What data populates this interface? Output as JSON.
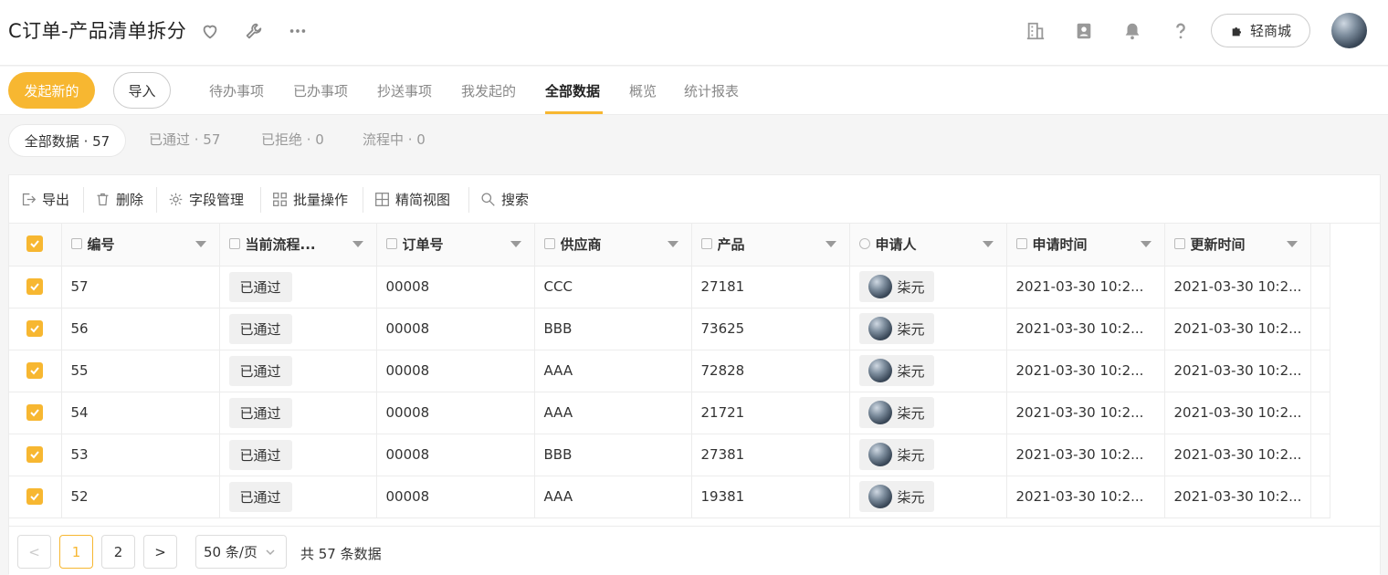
{
  "header": {
    "title": "C订单-产品清单拆分",
    "shop_label": "轻商城",
    "icons": [
      "heart-icon",
      "wrench-icon",
      "more-icon",
      "building-icon",
      "contacts-icon",
      "bell-icon",
      "help-icon",
      "puzzle-icon"
    ]
  },
  "subnav": {
    "new_label": "发起新的",
    "import_label": "导入",
    "tabs": [
      {
        "label": "待办事项"
      },
      {
        "label": "已办事项"
      },
      {
        "label": "抄送事项"
      },
      {
        "label": "我发起的"
      },
      {
        "label": "全部数据"
      },
      {
        "label": "概览"
      },
      {
        "label": "统计报表"
      }
    ],
    "active_tab": "全部数据",
    "accent_color": "#f7b731"
  },
  "filters": [
    {
      "label": "全部数据 · 57"
    },
    {
      "label": "已通过 · 57"
    },
    {
      "label": "已拒绝 · 0"
    },
    {
      "label": "流程中 · 0"
    }
  ],
  "toolbar": {
    "export_label": "导出",
    "delete_label": "删除",
    "fields_label": "字段管理",
    "batch_label": "批量操作",
    "view_label": "精简视图",
    "search_label": "搜索"
  },
  "table": {
    "columns": [
      "编号",
      "当前流程...",
      "订单号",
      "供应商",
      "产品",
      "申请人",
      "申请时间",
      "更新时间"
    ],
    "rows": [
      {
        "id": "57",
        "status": "已通过",
        "order": "00008",
        "supplier": "CCC",
        "product": "27181",
        "applicant": "柒元",
        "applied": "2021-03-30 10:2...",
        "updated": "2021-03-30 10:2..."
      },
      {
        "id": "56",
        "status": "已通过",
        "order": "00008",
        "supplier": "BBB",
        "product": "73625",
        "applicant": "柒元",
        "applied": "2021-03-30 10:2...",
        "updated": "2021-03-30 10:2..."
      },
      {
        "id": "55",
        "status": "已通过",
        "order": "00008",
        "supplier": "AAA",
        "product": "72828",
        "applicant": "柒元",
        "applied": "2021-03-30 10:2...",
        "updated": "2021-03-30 10:2..."
      },
      {
        "id": "54",
        "status": "已通过",
        "order": "00008",
        "supplier": "AAA",
        "product": "21721",
        "applicant": "柒元",
        "applied": "2021-03-30 10:2...",
        "updated": "2021-03-30 10:2..."
      },
      {
        "id": "53",
        "status": "已通过",
        "order": "00008",
        "supplier": "BBB",
        "product": "27381",
        "applicant": "柒元",
        "applied": "2021-03-30 10:2...",
        "updated": "2021-03-30 10:2..."
      },
      {
        "id": "52",
        "status": "已通过",
        "order": "00008",
        "supplier": "AAA",
        "product": "19381",
        "applicant": "柒元",
        "applied": "2021-03-30 10:2...",
        "updated": "2021-03-30 10:2..."
      }
    ]
  },
  "pagination": {
    "prev": "<",
    "pages": [
      "1",
      "2"
    ],
    "current": "1",
    "next": ">",
    "page_size": "50 条/页",
    "total": "共 57 条数据"
  }
}
